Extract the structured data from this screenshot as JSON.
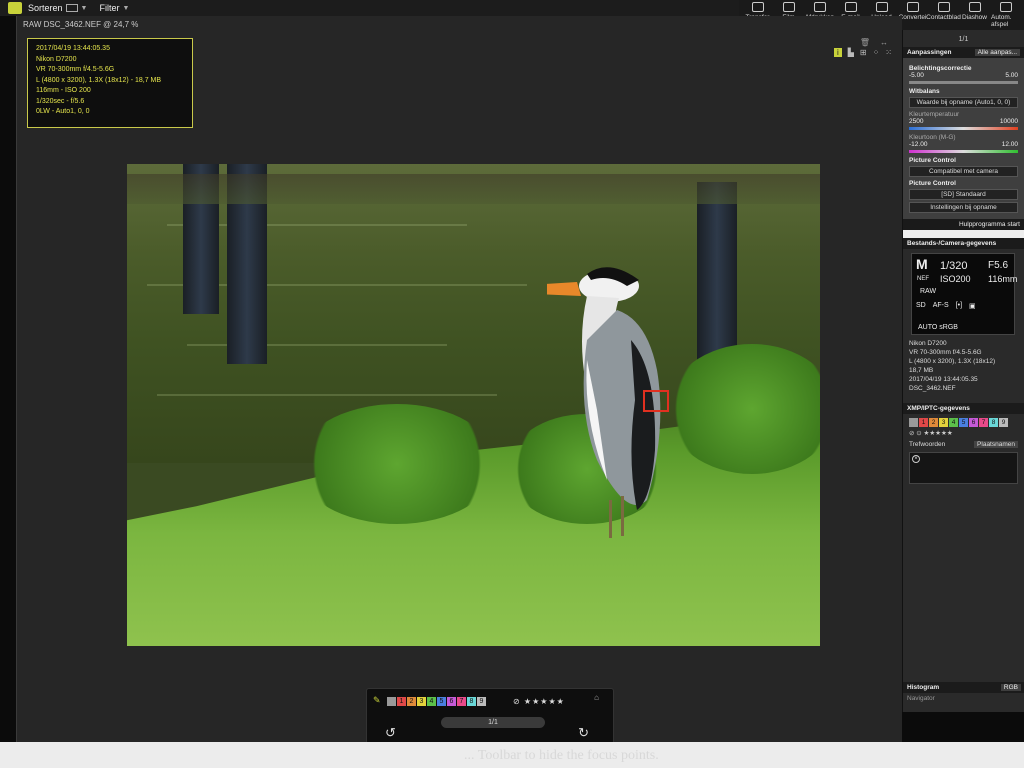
{
  "menubar": {
    "sort_label": "Sorteren",
    "filter_label": "Filter"
  },
  "toolbar": [
    {
      "icon": "camera-icon",
      "label": "Transfer"
    },
    {
      "icon": "film-icon",
      "label": "Film"
    },
    {
      "icon": "printer-icon",
      "label": "Afdrukken"
    },
    {
      "icon": "mail-icon",
      "label": "E-mail"
    },
    {
      "icon": "upload-icon",
      "label": "Upload"
    },
    {
      "icon": "convert-icon",
      "label": "Convertei"
    },
    {
      "icon": "contactsheet-icon",
      "label": "Contactblad"
    },
    {
      "icon": "slideshow-icon",
      "label": "Diashow"
    },
    {
      "icon": "autoplay-icon",
      "label": "Autom. afspel"
    }
  ],
  "viewer": {
    "title": "RAW   DSC_3462.NEF @ 24,7 %",
    "info_lines": [
      "2017/04/19 13:44:05.35",
      "Nikon D7200",
      "VR 70-300mm f/4.5-5.6G",
      "L (4800 x 3200), 1.3X (18x12) - 18,7 MB",
      "116mm - ISO 200",
      "1/320sec - f/5.6",
      "0LW - Auto1, 0, 0"
    ]
  },
  "bottombar": {
    "color_labels": [
      "1",
      "2",
      "3",
      "4",
      "5",
      "6",
      "7",
      "8",
      "9"
    ],
    "stars": "⊘ ★★★★★",
    "page": "1/1"
  },
  "hint_text": "... Toolbar to hide the focus points.",
  "panel": {
    "count": "1/1",
    "adjust_header": "Aanpassingen",
    "adjust_select": "Alle aanpas...",
    "exposure_label": "Belichtingscorrectie",
    "exposure_min": "-5.00",
    "exposure_max": "5.00",
    "wb_label": "Witbalans",
    "wb_value": "Waarde bij opname (Auto1, 0, 0)",
    "temp_label": "Kleurtemperatuur",
    "temp_min": "2500",
    "temp_max": "10000",
    "tint_label": "Kleurtoon (M-G)",
    "tint_min": "-12.00",
    "tint_max": "12.00",
    "pc_label": "Picture Control",
    "pc_value": "Compatibel met camera",
    "pc_label2": "Picture Control",
    "pc_value2": "[SD] Standaard",
    "pc_settings": "Instellingen bij opname",
    "helper": "Hulpprogramma start",
    "file_header": "Bestands-/Camera-gegevens",
    "cam_mode": "M",
    "cam_shutter": "1/320",
    "cam_aperture": "F5.6",
    "cam_nef": "NEF",
    "cam_iso": "ISO200",
    "cam_focal": "116mm",
    "cam_raw": "RAW",
    "cam_row": [
      "SD",
      "AF-S",
      "[•]",
      "▣"
    ],
    "cam_auto": "AUTO  sRGB",
    "file_lines": [
      "Nikon D7200",
      "VR 70-300mm f/4.5-5.6G",
      "L (4800 x 3200), 1.3X (18x12)",
      "18,7 MB",
      "2017/04/19 13:44:05.35",
      "DSC_3462.NEF"
    ],
    "xmp_header": "XMP/IPTC-gegevens",
    "xmp_labels": [
      "1",
      "2",
      "3",
      "4",
      "5",
      "6",
      "7",
      "8",
      "9"
    ],
    "xmp_stars": "⊘ ⊙ ★★★★★",
    "keywords_label": "Trefwoorden",
    "keywords_button": "Plaatsnamen",
    "histogram_header": "Histogram",
    "histogram_mode": "RGB",
    "navigator": "Navigator"
  }
}
